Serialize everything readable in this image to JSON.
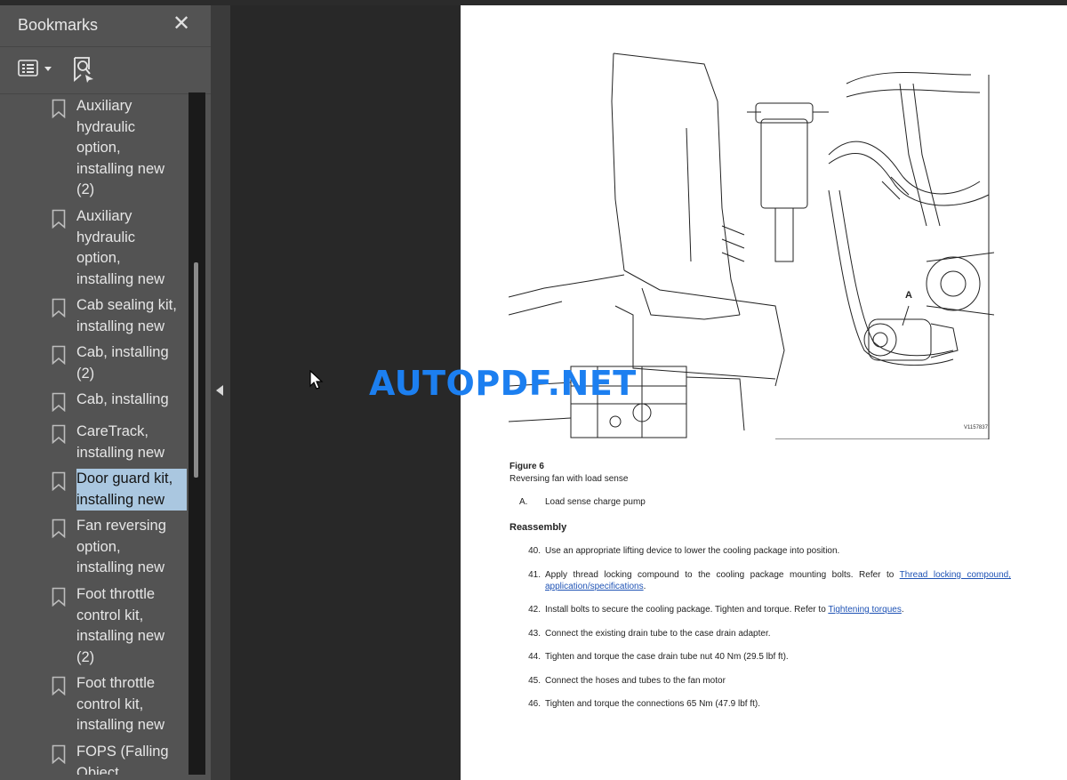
{
  "sidebar": {
    "title": "Bookmarks",
    "close_glyph": "✕",
    "tools": [
      {
        "icon": "bookmark-options-icon"
      },
      {
        "icon": "find-bookmark-icon"
      }
    ],
    "items": [
      {
        "label": "Auxiliary\nhydraulic\noption,\ninstalling new\n(2)",
        "icon": "bookmark-icon",
        "selected": false
      },
      {
        "label": "Auxiliary\nhydraulic\noption,\ninstalling new",
        "icon": "bookmark-icon",
        "selected": false
      },
      {
        "label": "Cab sealing kit,\ninstalling new",
        "icon": "bookmark-icon",
        "selected": false
      },
      {
        "label": "Cab, installing\n(2)",
        "icon": "bookmark-icon",
        "selected": false
      },
      {
        "label": "Cab, installing",
        "icon": "bookmark-icon",
        "selected": false
      },
      {
        "label": "CareTrack,\ninstalling new",
        "icon": "bookmark-icon",
        "selected": false
      },
      {
        "label": "Door guard kit,\ninstalling new",
        "icon": "bookmark-icon",
        "selected": true
      },
      {
        "label": "Fan reversing\noption,\ninstalling new",
        "icon": "bookmark-icon",
        "selected": false
      },
      {
        "label": "Foot throttle\ncontrol kit,\ninstalling new\n(2)",
        "icon": "bookmark-icon",
        "selected": false
      },
      {
        "label": "Foot throttle\ncontrol kit,\ninstalling new",
        "icon": "bookmark-icon",
        "selected": false
      },
      {
        "label": "FOPS (Falling\nObject",
        "icon": "bookmark-icon",
        "selected": false
      }
    ]
  },
  "document": {
    "figure_callout": "A",
    "figure_id": "V1157837",
    "figure_title": "Figure 6",
    "figure_caption": "Reversing fan with load sense",
    "legend": [
      {
        "letter": "A.",
        "text": "Load sense charge pump"
      }
    ],
    "section_heading": "Reassembly",
    "steps": [
      {
        "num": "40.",
        "text": "Use an appropriate lifting device to lower the cooling package into position."
      },
      {
        "num": "41.",
        "text_before": "Apply thread locking compound to the cooling package mounting bolts. Refer to ",
        "link": "Thread locking compound, application/specifications",
        "text_after": "."
      },
      {
        "num": "42.",
        "text_before": "Install bolts to secure the cooling package. Tighten and torque. Refer to ",
        "link": "Tightening torques",
        "text_after": "."
      },
      {
        "num": "43.",
        "text": "Connect the existing drain tube to the case drain adapter."
      },
      {
        "num": "44.",
        "text": "Tighten and torque the case drain tube nut 40 Nm (29.5 lbf ft)."
      },
      {
        "num": "45.",
        "text": "Connect the hoses and tubes to the fan motor"
      },
      {
        "num": "46.",
        "text": "Tighten and torque the connections 65 Nm (47.9 lbf ft)."
      }
    ]
  },
  "watermark": "AUTOPDF.NET",
  "colors": {
    "selection": "#aac7e0",
    "link": "#1f53b5",
    "watermark": "#1c7ff0"
  }
}
